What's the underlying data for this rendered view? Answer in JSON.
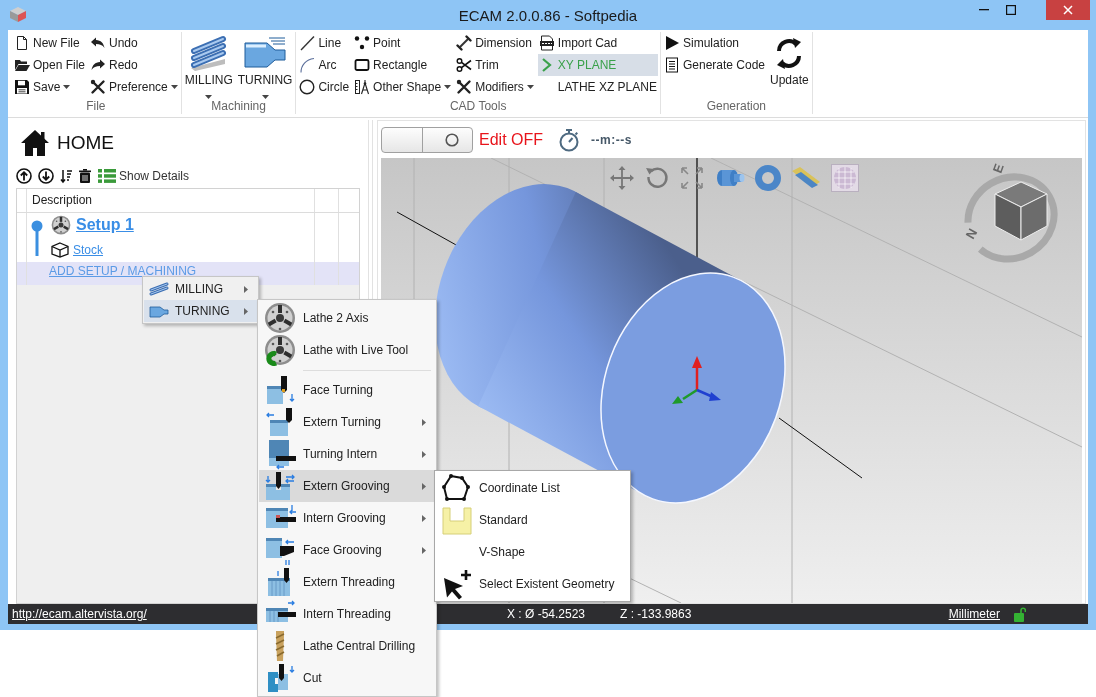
{
  "window": {
    "title": "ECAM 2.0.0.86 - Softpedia"
  },
  "ribbon": {
    "groups": [
      {
        "label": "File",
        "columns": [
          [
            {
              "label": "New File",
              "kind": "small",
              "dropdown": false
            },
            {
              "label": "Open File",
              "kind": "small",
              "dropdown": false
            },
            {
              "label": "Save",
              "kind": "small",
              "dropdown": true
            }
          ],
          [
            {
              "label": "Undo",
              "kind": "small",
              "dropdown": false
            },
            {
              "label": "Redo",
              "kind": "small",
              "dropdown": false
            },
            {
              "label": "Preference",
              "kind": "small",
              "dropdown": true
            }
          ]
        ]
      },
      {
        "label": "Machining",
        "columns": [
          [
            {
              "label": "MILLING",
              "kind": "large",
              "dropdown": true
            }
          ],
          [
            {
              "label": "TURNING",
              "kind": "large",
              "dropdown": true
            }
          ]
        ]
      },
      {
        "label": "CAD Tools",
        "columns": [
          [
            {
              "label": "Line",
              "kind": "small",
              "dropdown": false
            },
            {
              "label": "Arc",
              "kind": "small",
              "dropdown": false
            },
            {
              "label": "Circle",
              "kind": "small",
              "dropdown": false
            }
          ],
          [
            {
              "label": "Point",
              "kind": "small",
              "dropdown": false
            },
            {
              "label": "Rectangle",
              "kind": "small",
              "dropdown": false
            },
            {
              "label": "Other Shape",
              "kind": "small",
              "dropdown": true
            }
          ],
          [
            {
              "label": "Dimension",
              "kind": "small",
              "dropdown": false
            },
            {
              "label": "Trim",
              "kind": "small",
              "dropdown": false
            },
            {
              "label": "Modifiers",
              "kind": "small",
              "dropdown": true
            }
          ],
          [
            {
              "label": "Import Cad",
              "kind": "small",
              "dropdown": false
            },
            {
              "label": "XY PLANE",
              "kind": "plane",
              "selected": true
            },
            {
              "label": "LATHE XZ PLANE",
              "kind": "plane",
              "selected": false
            }
          ]
        ]
      },
      {
        "label": "Generation",
        "columns": [
          [
            {
              "label": "Simulation",
              "kind": "small",
              "dropdown": false
            },
            {
              "label": "Generate Code",
              "kind": "small",
              "dropdown": false
            }
          ],
          [
            {
              "label": "Update",
              "kind": "large",
              "dropdown": false
            }
          ]
        ]
      }
    ]
  },
  "project_panel": {
    "title": "HOME",
    "show_details": "Show Details",
    "table": {
      "columns": [
        {
          "label": "Description"
        }
      ],
      "rows": [
        {
          "label": "Setup 1",
          "kind": "setup",
          "selected": false,
          "children": [
            {
              "label": "Stock",
              "kind": "stock",
              "selected": false
            }
          ]
        },
        {
          "label": "ADD SETUP / MACHINING",
          "kind": "add",
          "selected": true
        }
      ]
    }
  },
  "viewport": {
    "edit_toggle": {
      "on": false,
      "label": "Edit OFF"
    },
    "timer": "--m:--s",
    "compass_labels": [
      "E",
      "N"
    ]
  },
  "status_bar": {
    "link": "http://ecam.altervista.org/",
    "x_coordinate": "X : Ø -54.2523",
    "z_coordinate": "Z : -133.9863",
    "unit": "Millimeter",
    "locked": false
  },
  "context_menu": {
    "items": [
      {
        "label": "MILLING",
        "submenu": true,
        "selected": false
      },
      {
        "label": "TURNING",
        "submenu": true,
        "selected": true
      }
    ]
  },
  "turning_menu": {
    "items": [
      {
        "kind": "item",
        "label": "Lathe 2 Axis",
        "submenu": false,
        "selected": false
      },
      {
        "kind": "item",
        "label": "Lathe with Live Tool",
        "submenu": false,
        "selected": false
      },
      {
        "kind": "separator"
      },
      {
        "kind": "item",
        "label": "Face Turning",
        "submenu": false,
        "selected": false
      },
      {
        "kind": "item",
        "label": "Extern Turning",
        "submenu": true,
        "selected": false
      },
      {
        "kind": "item",
        "label": "Turning Intern",
        "submenu": true,
        "selected": false
      },
      {
        "kind": "item",
        "label": "Extern Grooving",
        "submenu": true,
        "selected": true
      },
      {
        "kind": "item",
        "label": "Intern Grooving",
        "submenu": true,
        "selected": false
      },
      {
        "kind": "item",
        "label": "Face Grooving",
        "submenu": true,
        "selected": false
      },
      {
        "kind": "item",
        "label": "Extern Threading",
        "submenu": false,
        "selected": false
      },
      {
        "kind": "item",
        "label": "Intern Threading",
        "submenu": false,
        "selected": false
      },
      {
        "kind": "item",
        "label": "Lathe Central Drilling",
        "submenu": false,
        "selected": false
      },
      {
        "kind": "item",
        "label": "Cut",
        "submenu": false,
        "selected": false
      }
    ]
  },
  "grooving_menu": {
    "items": [
      {
        "label": "Coordinate List",
        "selected": false
      },
      {
        "label": "Standard",
        "selected": false
      },
      {
        "label": "V-Shape",
        "selected": false
      },
      {
        "label": "Select Existent Geometry",
        "selected": false
      }
    ]
  }
}
